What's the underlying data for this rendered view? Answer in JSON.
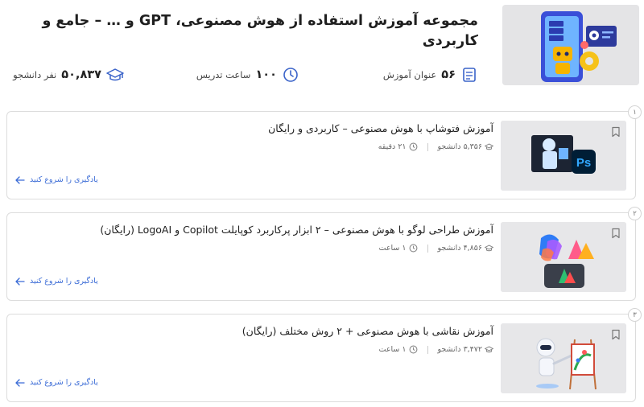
{
  "header": {
    "title": "مجموعه آموزش استفاده از هوش مصنوعی، GPT و … – جامع و کاربردی",
    "stats": {
      "courses": {
        "value": "۵۶",
        "label": "عنوان آموزش",
        "icon": "book-icon"
      },
      "hours": {
        "value": "۱۰۰",
        "label": "ساعت تدریس",
        "icon": "clock-icon"
      },
      "students": {
        "value": "۵۰,۸۳۷",
        "label": "نفر دانشجو",
        "icon": "graduation-cap-icon"
      }
    }
  },
  "courses": [
    {
      "index": "۱",
      "title": "آموزش فتوشاپ با هوش مصنوعی – کاربردی و رایگان",
      "students": "۵,۳۵۶ دانشجو",
      "duration": "۲۱ دقیقه",
      "cta": "یادگیری را شروع کنید"
    },
    {
      "index": "۲",
      "title": "آموزش طراحی لوگو با هوش مصنوعی – ۲ ابزار پرکاربرد کوپایلت Copilot و LogoAI (رایگان)",
      "students": "۴,۸۵۶ دانشجو",
      "duration": "۱ ساعت",
      "cta": "یادگیری را شروع کنید"
    },
    {
      "index": "۳",
      "title": "آموزش نقاشی با هوش مصنوعی + ۲ روش مختلف (رایگان)",
      "students": "۳,۴۷۲ دانشجو",
      "duration": "۱ ساعت",
      "cta": "یادگیری را شروع کنید"
    }
  ],
  "thumb_labels": {
    "photoshop": "Ps"
  },
  "colors": {
    "accent": "#3a6bd6",
    "ps_bg": "#001e36",
    "ps_fg": "#31a8ff"
  }
}
